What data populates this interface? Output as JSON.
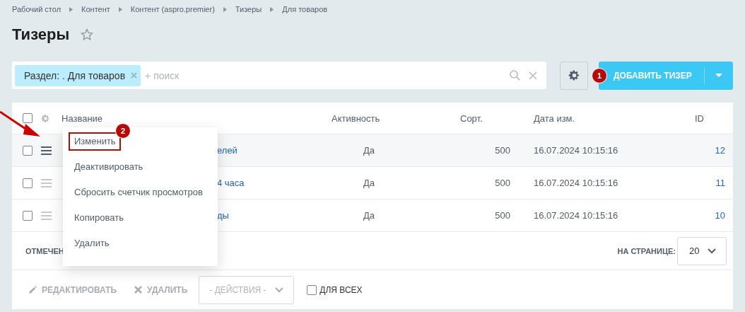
{
  "breadcrumbs": [
    "Рабочий стол",
    "Контент",
    "Контент (aspro.premier)",
    "Тизеры",
    "Для товаров"
  ],
  "title": "Тизеры",
  "favorite": false,
  "filter": {
    "tag": "Раздел: . Для товаров",
    "placeholder": "+ поиск"
  },
  "add_button": {
    "label": "ДОБАВИТЬ ТИЗЕР",
    "badge": "1"
  },
  "table": {
    "all_checked": false,
    "columns": [
      "Название",
      "Активность",
      "Сорт.",
      "Дата изм.",
      "ID"
    ],
    "rows": [
      {
        "name": "елей",
        "active": "Да",
        "sort": "500",
        "date": "16.07.2024 10:15:16",
        "id": "12",
        "checked": false,
        "hovered": true
      },
      {
        "name": "4 часа",
        "active": "Да",
        "sort": "500",
        "date": "16.07.2024 10:15:16",
        "id": "11",
        "checked": false,
        "hovered": false
      },
      {
        "name": "ды",
        "active": "Да",
        "sort": "500",
        "date": "16.07.2024 10:15:16",
        "id": "10",
        "checked": false,
        "hovered": false
      }
    ],
    "footer_label": "ОТМЕЧЕН",
    "per_page_label": "НА СТРАНИЦЕ:",
    "per_page": "20"
  },
  "context_menu": {
    "badge": "2",
    "items": [
      {
        "label": "Изменить",
        "outlined": true
      },
      {
        "label": "Деактивировать",
        "outlined": false
      },
      {
        "label": "Сбросить счетчик просмотров",
        "outlined": false
      },
      {
        "label": "Копировать",
        "outlined": false
      },
      {
        "label": "Удалить",
        "outlined": false
      }
    ]
  },
  "actions": {
    "edit": "РЕДАКТИРОВАТЬ",
    "delete": "УДАЛИТЬ",
    "select": "- ДЕЙСТВИЯ -",
    "for_all": "ДЛЯ ВСЕХ",
    "for_all_checked": false
  }
}
